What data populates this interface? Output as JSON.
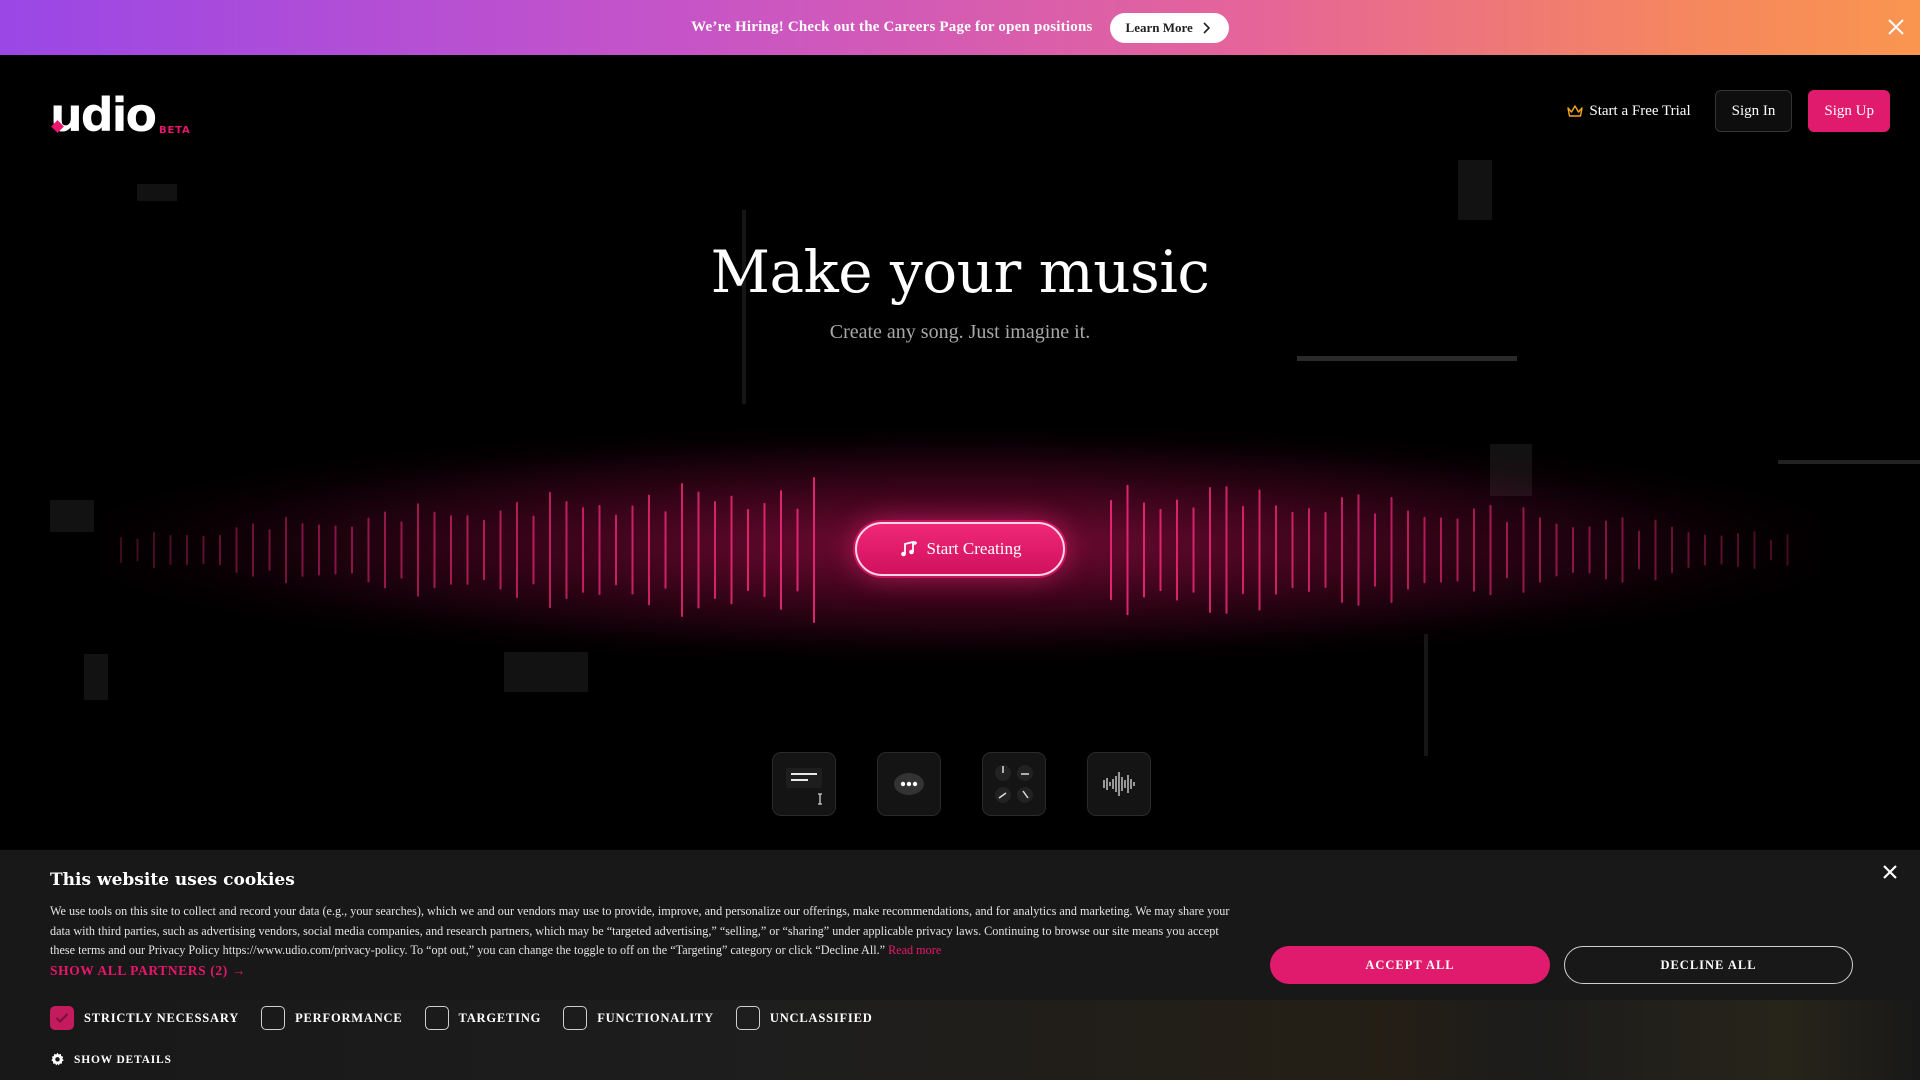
{
  "banner": {
    "text": "We’re Hiring! Check out the Careers Page for open positions",
    "button_label": "Learn More"
  },
  "header": {
    "logo_text": "udio",
    "logo_badge": "BETA",
    "trial_label": "Start a Free Trial",
    "signin_label": "Sign In",
    "signup_label": "Sign Up"
  },
  "hero": {
    "title": "Make your music",
    "subtitle": "Create any song. Just imagine it.",
    "cta_label": "Start Creating"
  },
  "tiles": [
    {
      "name": "lyrics-tile",
      "icon": "text-lines-icon"
    },
    {
      "name": "chat-tile",
      "icon": "chat-bubble-icon"
    },
    {
      "name": "controls-tile",
      "icon": "knobs-icon"
    },
    {
      "name": "audio-tile",
      "icon": "waveform-icon"
    }
  ],
  "cookie": {
    "title": "This website uses cookies",
    "body": "We use tools on this site to collect and record your data (e.g., your searches), which we and our vendors may use to provide, improve, and personalize our offerings, make recommendations, and for analytics and marketing. We may share your data with third parties, such as advertising vendors, social media companies, and research partners, which may be “targeted advertising,” “selling,” or “sharing” under applicable privacy laws. Continuing to browse our site means you accept these terms and our Privacy Policy https://www.udio.com/privacy-policy. To “opt out,” you can change the toggle to off on the “Targeting” category or click “Decline All.”",
    "read_more": "Read more",
    "show_partners": "SHOW ALL PARTNERS (2) →",
    "accept_label": "ACCEPT ALL",
    "decline_label": "DECLINE ALL",
    "categories": [
      {
        "label": "STRICTLY NECESSARY",
        "checked": true
      },
      {
        "label": "PERFORMANCE",
        "checked": false
      },
      {
        "label": "TARGETING",
        "checked": false
      },
      {
        "label": "FUNCTIONALITY",
        "checked": false
      },
      {
        "label": "UNCLASSIFIED",
        "checked": false
      }
    ],
    "show_details": "SHOW DETAILS"
  },
  "colors": {
    "accent": "#e01a6c",
    "background": "#000000",
    "cookie_bg": "#181818"
  }
}
